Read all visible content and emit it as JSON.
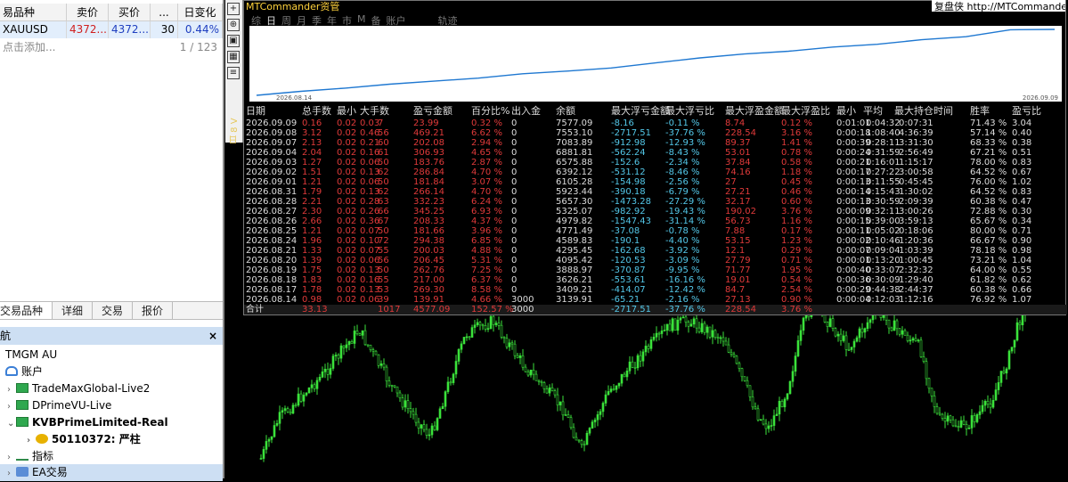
{
  "market_watch": {
    "headers": [
      "易品种",
      "卖价",
      "买价",
      "...",
      "日变化"
    ],
    "row": {
      "symbol": "XAUUSD",
      "bid": "4372...",
      "ask": "4372...",
      "spread": "30",
      "change": "0.44%"
    },
    "add_label": "点击添加...",
    "count": "1 / 123",
    "tabs": [
      "交易品种",
      "详细",
      "交易",
      "报价"
    ]
  },
  "navigator": {
    "title": "航",
    "close_label": "×",
    "items": [
      {
        "label": "TMGM AU",
        "indent": 6
      },
      {
        "label": "账户",
        "indent": 6
      },
      {
        "label": "TradeMaxGlobal-Live2",
        "indent": 6
      },
      {
        "label": "DPrimeVU-Live",
        "indent": 6
      },
      {
        "label": "KVBPrimeLimited-Real",
        "indent": 6
      },
      {
        "label": "50110372: 严柱",
        "indent": 30
      },
      {
        "label": "指标",
        "indent": 6
      },
      {
        "label": "EA交易",
        "indent": 6
      }
    ]
  },
  "panel": {
    "title": "MTCommander资管",
    "top_link": "复盘侠 http://MTCommander",
    "period_tabs": [
      "综",
      "日",
      "周",
      "月",
      "季",
      "年",
      "市",
      "M",
      "备",
      "账户"
    ],
    "track_label": "轨迹",
    "curve_start_date": "2026.08.14",
    "curve_end_date": "2026.09.09",
    "vertical_tab": "日 8 V",
    "columns": [
      "日期",
      "总手数",
      "最小",
      "大手数",
      "盈亏金额",
      "百分比%",
      "出入金",
      "余额",
      "最大浮亏金额",
      "最大浮亏比",
      "最大浮盈金额",
      "最大浮盈比",
      "最小",
      "平均",
      "最大持仓时间",
      "胜率",
      "盈亏比"
    ],
    "rows": [
      [
        "2026.09.09",
        "0.16",
        "0.02",
        "0.03",
        "7",
        "23.99",
        "0.32 %",
        "0",
        "7577.09",
        "-8.16",
        "-0.11 %",
        "8.74",
        "0.12 %",
        "0:01:01",
        "0:04:32",
        "0:07:31",
        "71.43 %",
        "3.04"
      ],
      [
        "2026.09.08",
        "3.12",
        "0.02",
        "0.46",
        "56",
        "469.21",
        "6.62 %",
        "0",
        "7553.10",
        "-2717.51",
        "-37.76 %",
        "228.54",
        "3.16 %",
        "0:00:18",
        "1:08:40",
        "4:36:39",
        "57.14 %",
        "0.40"
      ],
      [
        "2026.09.07",
        "2.13",
        "0.02",
        "0.21",
        "60",
        "202.08",
        "2.94 %",
        "0",
        "7083.89",
        "-912.98",
        "-12.93 %",
        "89.37",
        "1.41 %",
        "0:00:39",
        "0:28:11",
        "3:31:30",
        "68.33 %",
        "0.38"
      ],
      [
        "2026.09.04",
        "2.04",
        "0.02",
        "0.16",
        "61",
        "306.93",
        "4.65 %",
        "0",
        "6881.81",
        "-562.24",
        "-8.43 %",
        "53.01",
        "0.78 %",
        "0:00:24",
        "0:31:59",
        "2:56:49",
        "67.21 %",
        "0.51"
      ],
      [
        "2026.09.03",
        "1.27",
        "0.02",
        "0.06",
        "50",
        "183.76",
        "2.87 %",
        "0",
        "6575.88",
        "-152.6",
        "-2.34 %",
        "37.84",
        "0.58 %",
        "0:00:21",
        "0:16:01",
        "1:15:17",
        "78.00 %",
        "0.83"
      ],
      [
        "2026.09.02",
        "1.51",
        "0.02",
        "0.13",
        "62",
        "286.84",
        "4.70 %",
        "0",
        "6392.12",
        "-531.12",
        "-8.46 %",
        "74.16",
        "1.18 %",
        "0:00:17",
        "0:27:22",
        "3:00:58",
        "64.52 %",
        "0.67"
      ],
      [
        "2026.09.01",
        "1.21",
        "0.02",
        "0.06",
        "50",
        "181.84",
        "3.07 %",
        "0",
        "6105.28",
        "-154.98",
        "-2.56 %",
        "27",
        "0.45 %",
        "0:00:13",
        "0:11:55",
        "0:45:45",
        "76.00 %",
        "1.02"
      ],
      [
        "2026.08.31",
        "1.79",
        "0.02",
        "0.13",
        "62",
        "266.14",
        "4.70 %",
        "0",
        "5923.44",
        "-390.18",
        "-6.79 %",
        "27.21",
        "0.46 %",
        "0:00:14",
        "0:15:43",
        "1:30:02",
        "64.52 %",
        "0.83"
      ],
      [
        "2026.08.28",
        "2.21",
        "0.02",
        "0.28",
        "63",
        "332.23",
        "6.24 %",
        "0",
        "5657.30",
        "-1473.28",
        "-27.29 %",
        "32.17",
        "0.60 %",
        "0:00:13",
        "0:30:59",
        "2:09:39",
        "60.38 %",
        "0.47"
      ],
      [
        "2026.08.27",
        "2.30",
        "0.02",
        "0.26",
        "66",
        "345.25",
        "6.93 %",
        "0",
        "5325.07",
        "-982.92",
        "-19.43 %",
        "190.02",
        "3.76 %",
        "0:00:09",
        "0:32:11",
        "3:00:26",
        "72.88 %",
        "0.30"
      ],
      [
        "2026.08.26",
        "2.66",
        "0.02",
        "0.36",
        "67",
        "208.33",
        "4.37 %",
        "0",
        "4979.82",
        "-1547.43",
        "-31.14 %",
        "56.73",
        "1.16 %",
        "0:00:15",
        "0:39:00",
        "3:59:13",
        "65.67 %",
        "0.34"
      ],
      [
        "2026.08.25",
        "1.21",
        "0.02",
        "0.07",
        "50",
        "181.66",
        "3.96 %",
        "0",
        "4771.49",
        "-37.08",
        "-0.78 %",
        "7.88",
        "0.17 %",
        "0:00:11",
        "0:05:02",
        "0:18:06",
        "80.00 %",
        "0.71"
      ],
      [
        "2026.08.24",
        "1.96",
        "0.02",
        "0.10",
        "72",
        "294.38",
        "6.85 %",
        "0",
        "4589.83",
        "-190.1",
        "-4.40 %",
        "53.15",
        "1.23 %",
        "0:00:02",
        "0:10:46",
        "1:20:36",
        "66.67 %",
        "0.90"
      ],
      [
        "2026.08.21",
        "1.33",
        "0.02",
        "0.07",
        "55",
        "200.03",
        "4.88 %",
        "0",
        "4295.45",
        "-162.68",
        "-3.92 %",
        "12.1",
        "0.29 %",
        "0:00:07",
        "0:09:04",
        "1:03:39",
        "78.18 %",
        "0.98"
      ],
      [
        "2026.08.20",
        "1.39",
        "0.02",
        "0.06",
        "56",
        "206.45",
        "5.31 %",
        "0",
        "4095.42",
        "-120.53",
        "-3.09 %",
        "27.79",
        "0.71 %",
        "0:00:01",
        "0:13:20",
        "1:00:45",
        "73.21 %",
        "1.04"
      ],
      [
        "2026.08.19",
        "1.75",
        "0.02",
        "0.13",
        "50",
        "262.76",
        "7.25 %",
        "0",
        "3888.97",
        "-370.87",
        "-9.95 %",
        "71.77",
        "1.95 %",
        "0:00:40",
        "0:33:07",
        "2:32:32",
        "64.00 %",
        "0.55"
      ],
      [
        "2026.08.18",
        "1.83",
        "0.02",
        "0.16",
        "55",
        "217.00",
        "6.37 %",
        "0",
        "3626.21",
        "-553.61",
        "-16.16 %",
        "19.01",
        "0.54 %",
        "0:00:36",
        "0:30:09",
        "1:29:40",
        "61.82 %",
        "0.62"
      ],
      [
        "2026.08.17",
        "1.78",
        "0.02",
        "0.13",
        "53",
        "269.30",
        "8.58 %",
        "0",
        "3409.21",
        "-414.07",
        "-12.42 %",
        "84.7",
        "2.54 %",
        "0:00:29",
        "0:44:38",
        "2:44:37",
        "60.38 %",
        "0.66"
      ],
      [
        "2026.08.14",
        "0.98",
        "0.02",
        "0.06",
        "39",
        "139.91",
        "4.66 %",
        "3000",
        "3139.91",
        "-65.21",
        "-2.16 %",
        "27.13",
        "0.90 %",
        "0:00:04",
        "0:12:03",
        "1:12:16",
        "76.92 %",
        "1.07"
      ]
    ],
    "totals": [
      "合计",
      "33.13",
      "",
      "",
      "1017",
      "4577.09",
      "152.57 %",
      "3000",
      "",
      "-2717.51",
      "-37.76 %",
      "228.54",
      "3.76 %",
      "",
      "",
      "",
      "",
      ""
    ]
  },
  "colors": {
    "red": "#e03a3a",
    "cyan": "#53c7e8",
    "candle": "#3be23b",
    "title": "#ffd23c",
    "curve": "#1f78d1"
  },
  "balance_curve": [
    3139.91,
    3409.21,
    3626.21,
    3888.97,
    4095.42,
    4295.45,
    4589.83,
    4771.49,
    4979.82,
    5325.07,
    5657.3,
    5923.44,
    6105.28,
    6392.12,
    6575.88,
    6881.81,
    7083.89,
    7553.1,
    7577.09
  ]
}
